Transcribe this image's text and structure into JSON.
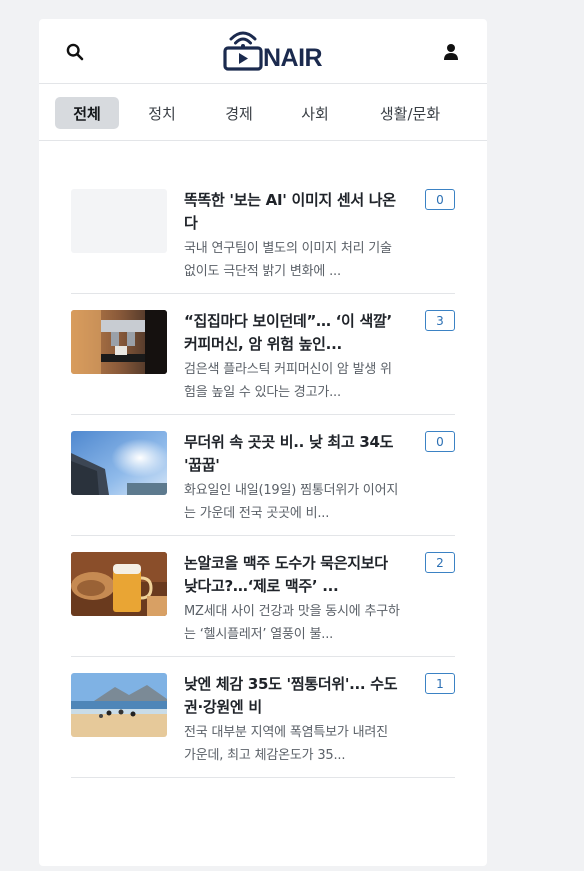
{
  "header": {
    "logo_text": "NAIR",
    "search_icon": "search-icon",
    "user_icon": "user-icon"
  },
  "tabs": [
    {
      "label": "전체",
      "active": true
    },
    {
      "label": "정치",
      "active": false
    },
    {
      "label": "경제",
      "active": false
    },
    {
      "label": "사회",
      "active": false
    },
    {
      "label": "생활/문화",
      "active": false
    }
  ],
  "articles": [
    {
      "title": "똑똑한 '보는 AI' 이미지 센서 나온다",
      "summary": "국내 연구팀이 별도의 이미지 처리 기술 없이도 극단적 밝기 변화에 ...",
      "comments": "0",
      "thumbnail": "blank"
    },
    {
      "title": "“집집마다 보이던데”… ‘이 색깔’ 커피머신, 암 위험 높인...",
      "summary": "검은색 플라스틱 커피머신이 암 발생 위험을 높일 수 있다는 경고가...",
      "comments": "3",
      "thumbnail": "coffee-machine-photo"
    },
    {
      "title": "무더위 속 곳곳 비.. 낮 최고 34도 '꿉꿉'",
      "summary": "화요일인 내일(19일) 찜통더위가 이어지는 가운데 전국 곳곳에 비...",
      "comments": "0",
      "thumbnail": "sky-building-photo"
    },
    {
      "title": "논알코올 맥주 도수가 묵은지보다 낮다고?…‘제로 맥주’ ...",
      "summary": "MZ세대 사이 건강과 맛을 동시에 추구하는 ‘헬시플레저’ 열풍이 불...",
      "comments": "2",
      "thumbnail": "beer-photo"
    },
    {
      "title": "낮엔 체감 35도 '찜통더위'... 수도권·강원엔 비",
      "summary": "전국 대부분 지역에 폭염특보가 내려진 가운데, 최고 체감온도가 35...",
      "comments": "1",
      "thumbnail": "beach-photo"
    }
  ],
  "colors": {
    "brand": "#1b2a4e",
    "badge_border": "#3b82c4",
    "active_tab_bg": "#d7dade"
  }
}
